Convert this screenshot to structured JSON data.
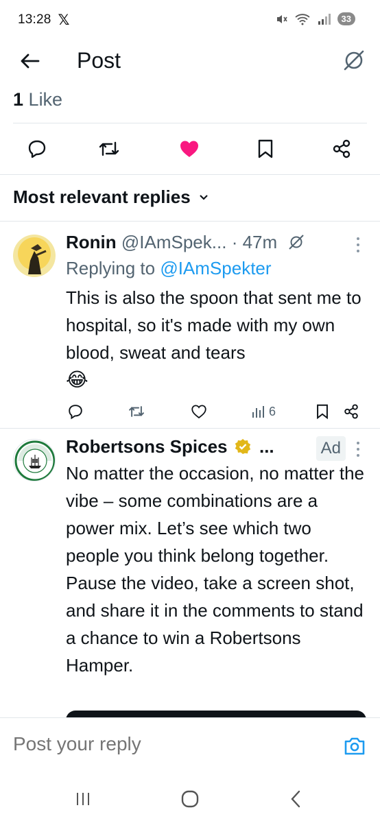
{
  "status_bar": {
    "time": "13:28",
    "x_logo": "𝕏",
    "battery": "33"
  },
  "header": {
    "title": "Post"
  },
  "likes": {
    "count": "1",
    "label": "Like"
  },
  "sort": {
    "label": "Most relevant replies"
  },
  "reply": {
    "name": "Ronin",
    "handle": "@IAmSpek...",
    "time": "· 47m",
    "replying_prefix": "Replying to ",
    "replying_handle": "@IAmSpekter",
    "text": "This is also the spoon that sent me to hospital, so it's made with my own blood, sweat and tears",
    "emoji": "😂",
    "views": "6"
  },
  "ad": {
    "name": "Robertsons Spices",
    "ellipsis": "...",
    "badge": "Ad",
    "text": "No matter the occasion, no matter the vibe – some combinations are a power mix. Let’s see which two people you think belong together.  Pause the video, take a screen shot, and share it in the comments to stand a chance to win a Robertsons Hamper.",
    "logo_top": "ROBERTSONS",
    "logo_bottom": "THE SPICE PEOPLE"
  },
  "reply_bar": {
    "placeholder": "Post your reply"
  },
  "colors": {
    "accent": "#1d9bf0",
    "like": "#f91880",
    "secondary": "#536471",
    "verified": "#e2b719"
  },
  "icons": [
    "back-arrow-icon",
    "grok-icon",
    "comment-icon",
    "repost-icon",
    "heart-icon",
    "bookmark-icon",
    "share-icon",
    "views-icon",
    "more-icon",
    "verified-icon",
    "camera-icon",
    "recents-icon",
    "home-icon",
    "back-icon"
  ]
}
